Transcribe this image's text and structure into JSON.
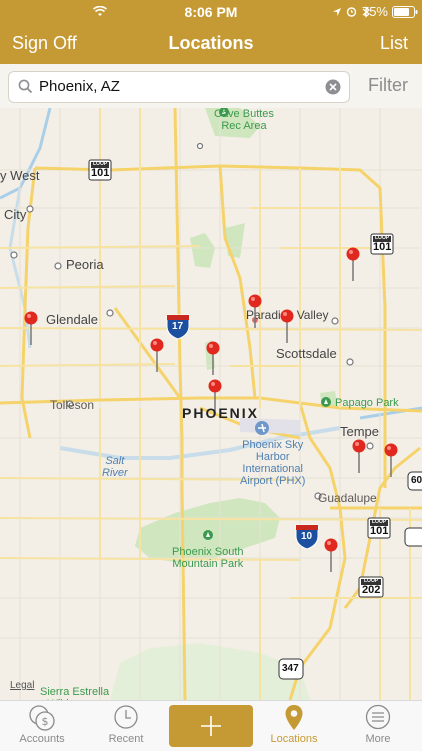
{
  "status_bar": {
    "time": "8:06 PM",
    "battery": "75%"
  },
  "nav": {
    "left": "Sign Off",
    "title": "Locations",
    "right": "List"
  },
  "search": {
    "value": "Phoenix, AZ",
    "filter_label": "Filter"
  },
  "map": {
    "labels": {
      "cave_buttes": "Cave Buttes\nRec Area",
      "city_west": "y West",
      "city": "City",
      "peoria": "Peoria",
      "glendale": "Glendale",
      "paradise_valley": "Paradise Valley",
      "scottsdale": "Scottsdale",
      "tolleson": "Tolleson",
      "phoenix": "PHOENIX",
      "papago": "Papago Park",
      "tempe": "Tempe",
      "sky_harbor": "Phoenix Sky\nHarbor\nInternational\nAirport (PHX)",
      "salt_river": "Salt\nRiver",
      "guadalupe": "Guadalupe",
      "south_mountain": "Phoenix South\nMountain Park",
      "sierra_estrella": "Sierra Estrella\nWilderness",
      "legal": "Legal"
    },
    "shields": {
      "loop101_nw": "101",
      "loop101_ne": "101",
      "loop101_se": "101",
      "loop202": "202",
      "i17": "17",
      "i10": "10",
      "us60": "60",
      "r347": "347",
      "loop_tag": "LOOP"
    }
  },
  "tabs": [
    {
      "label": "Accounts",
      "icon": "dollar-coins-icon"
    },
    {
      "label": "Recent",
      "icon": "clock-icon"
    },
    {
      "label": "",
      "icon": "plus-icon"
    },
    {
      "label": "Locations",
      "icon": "map-pin-icon"
    },
    {
      "label": "More",
      "icon": "menu-icon"
    }
  ],
  "colors": {
    "accent": "#c59a34",
    "pin": "#e0281e",
    "park": "#cfe6bf",
    "road": "#f5d36a"
  }
}
